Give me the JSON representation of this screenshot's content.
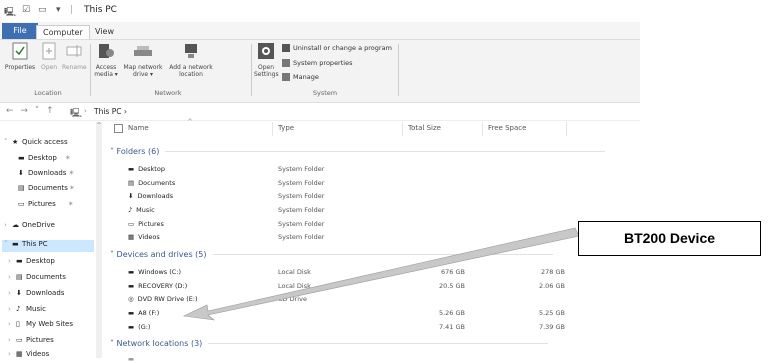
{
  "window": {
    "title": "This PC"
  },
  "tabs": {
    "file": "File",
    "computer": "Computer",
    "view": "View"
  },
  "ribbon": {
    "location": {
      "label": "Location",
      "properties": "Properties",
      "open": "Open",
      "rename": "Rename"
    },
    "network": {
      "label": "Network",
      "access_media": "Access media ▾",
      "map_drive": "Map network drive ▾",
      "add_location": "Add a network location"
    },
    "system": {
      "label": "System",
      "open_settings": "Open Settings",
      "uninstall": "Uninstall or change a program",
      "properties": "System properties",
      "manage": "Manage"
    }
  },
  "nav": {
    "breadcrumb": "This PC  ›"
  },
  "sidebar": {
    "quick_access": "Quick access",
    "desktop": "Desktop",
    "downloads": "Downloads",
    "documents": "Documents",
    "pictures": "Pictures",
    "onedrive": "OneDrive",
    "this_pc": "This PC",
    "pc_desktop": "Desktop",
    "pc_documents": "Documents",
    "pc_downloads": "Downloads",
    "pc_music": "Music",
    "pc_websites": "My Web Sites",
    "pc_pictures": "Pictures",
    "pc_videos": "Videos"
  },
  "columns": {
    "name": "Name",
    "type": "Type",
    "total_size": "Total Size",
    "free_space": "Free Space"
  },
  "folders": {
    "header": "Folders (6)",
    "items": [
      {
        "name": "Desktop",
        "type": "System Folder"
      },
      {
        "name": "Documents",
        "type": "System Folder"
      },
      {
        "name": "Downloads",
        "type": "System Folder"
      },
      {
        "name": "Music",
        "type": "System Folder"
      },
      {
        "name": "Pictures",
        "type": "System Folder"
      },
      {
        "name": "Videos",
        "type": "System Folder"
      }
    ]
  },
  "drives": {
    "header": "Devices and drives (5)",
    "items": [
      {
        "name": "Windows (C:)",
        "type": "Local Disk",
        "total": "676 GB",
        "free": "278 GB"
      },
      {
        "name": "RECOVERY (D:)",
        "type": "Local Disk",
        "total": "20.5 GB",
        "free": "2.06 GB"
      },
      {
        "name": "DVD RW Drive (E:)",
        "type": "CD Drive",
        "total": "",
        "free": ""
      },
      {
        "name": "A8 (F:)",
        "type": "",
        "total": "5.26 GB",
        "free": "5.25 GB"
      },
      {
        "name": "(G:)",
        "type": "",
        "total": "7.41 GB",
        "free": "7.39 GB"
      }
    ]
  },
  "network": {
    "header": "Network locations (3)"
  },
  "callout": {
    "text": "BT200 Device",
    "color": "#000000"
  },
  "colors": {
    "accent": "#3f6fb3",
    "selection": "#cce8ff",
    "arrow": "#c8c8c8"
  }
}
